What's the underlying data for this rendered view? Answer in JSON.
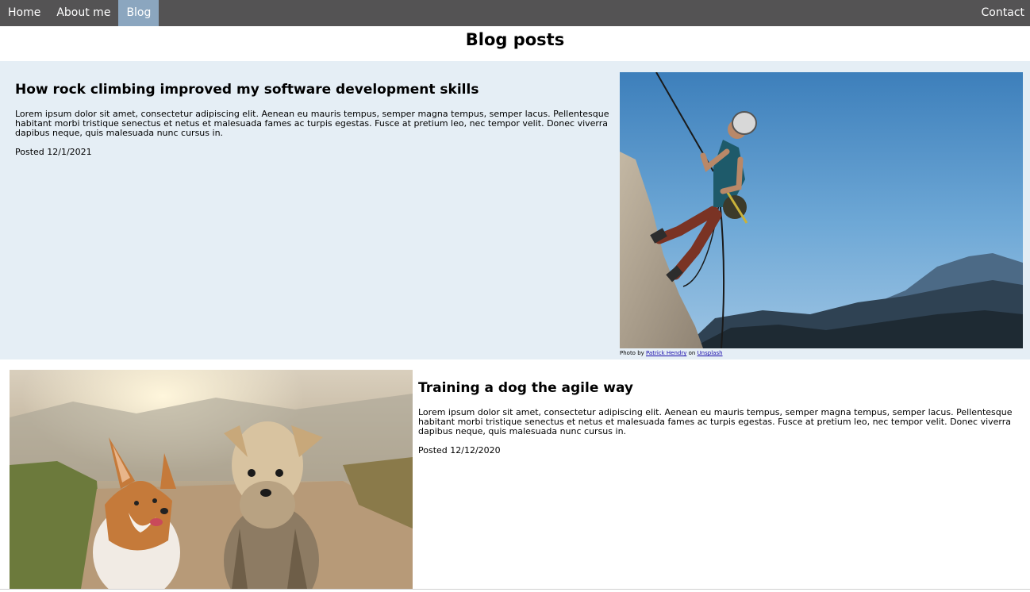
{
  "nav": {
    "home": "Home",
    "about": "About me",
    "blog": "Blog",
    "contact": "Contact"
  },
  "page": {
    "title": "Blog posts"
  },
  "posts": [
    {
      "title": "How rock climbing improved my software development skills",
      "body": "Lorem ipsum dolor sit amet, consectetur adipiscing elit. Aenean eu mauris tempus, semper magna tempus, semper lacus. Pellentesque habitant morbi tristique senectus et netus et malesuada fames ac turpis egestas. Fusce at pretium leo, nec tempor velit. Donec viverra dapibus neque, quis malesuada nunc cursus in.",
      "date": "Posted 12/1/2021",
      "credit": {
        "prefix": "Photo by ",
        "author": "Patrick Hendry",
        "middle": " on ",
        "site": "Unsplash"
      }
    },
    {
      "title": "Training a dog the agile way",
      "body": "Lorem ipsum dolor sit amet, consectetur adipiscing elit. Aenean eu mauris tempus, semper magna tempus, semper lacus. Pellentesque habitant morbi tristique senectus et netus et malesuada fames ac turpis egestas. Fusce at pretium leo, nec tempor velit. Donec viverra dapibus neque, quis malesuada nunc cursus in.",
      "date": "Posted 12/12/2020"
    }
  ],
  "colors": {
    "navbar": "#545354",
    "nav_active": "#8ba6bf",
    "post_highlight_bg": "#e5eef5",
    "link": "#1a0dab"
  }
}
